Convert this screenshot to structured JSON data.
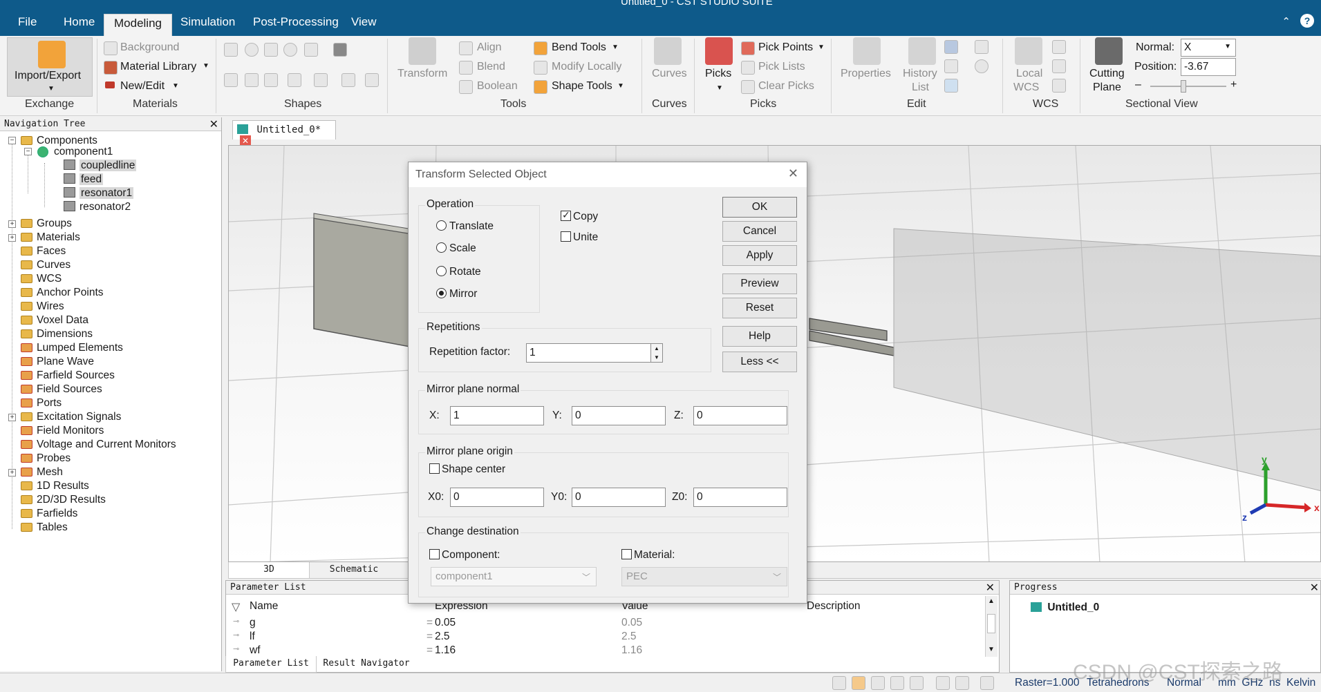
{
  "window": {
    "title": "Untitled_0 - CST STUDIO SUITE"
  },
  "menu": {
    "items": [
      "File",
      "Home",
      "Modeling",
      "Simulation",
      "Post-Processing",
      "View"
    ],
    "active": "Modeling"
  },
  "ribbon": {
    "exchange": {
      "label": "Exchange",
      "import_export": "Import/Export"
    },
    "materials": {
      "label": "Materials",
      "background": "Background",
      "material_library": "Material Library",
      "new_edit": "New/Edit"
    },
    "shapes": {
      "label": "Shapes"
    },
    "tools": {
      "label": "Tools",
      "transform": "Transform",
      "align": "Align",
      "blend": "Blend",
      "boolean": "Boolean",
      "bend_tools": "Bend Tools",
      "modify_locally": "Modify Locally",
      "shape_tools": "Shape Tools"
    },
    "curves": {
      "label": "Curves",
      "curves": "Curves"
    },
    "picks": {
      "label": "Picks",
      "picks": "Picks",
      "pick_points": "Pick Points",
      "pick_lists": "Pick Lists",
      "clear_picks": "Clear Picks"
    },
    "edit": {
      "label": "Edit",
      "properties": "Properties",
      "history": "History",
      "list": "List"
    },
    "wcs": {
      "label": "WCS",
      "local": "Local",
      "wcs": "WCS"
    },
    "sectional": {
      "label": "Sectional View",
      "cutting": "Cutting",
      "plane": "Plane",
      "normal_label": "Normal:",
      "normal_value": "X",
      "position_label": "Position:",
      "position_value": "-3.67"
    }
  },
  "nav": {
    "title": "Navigation Tree",
    "components": "Components",
    "component1": "component1",
    "solids": [
      "coupledline",
      "feed",
      "resonator1",
      "resonator2"
    ],
    "items": [
      "Groups",
      "Materials",
      "Faces",
      "Curves",
      "WCS",
      "Anchor Points",
      "Wires",
      "Voxel Data",
      "Dimensions",
      "Lumped Elements",
      "Plane Wave",
      "Farfield Sources",
      "Field Sources",
      "Ports",
      "Excitation Signals",
      "Field Monitors",
      "Voltage and Current Monitors",
      "Probes",
      "Mesh",
      "1D Results",
      "2D/3D Results",
      "Farfields",
      "Tables"
    ]
  },
  "doc_tab": {
    "label": "Untitled_0*"
  },
  "view_tabs": [
    "3D",
    "Schematic"
  ],
  "dialog": {
    "title": "Transform Selected Object",
    "operation": {
      "label": "Operation",
      "translate": "Translate",
      "scale": "Scale",
      "rotate": "Rotate",
      "mirror": "Mirror",
      "selected": "Mirror"
    },
    "copy": "Copy",
    "copy_checked": true,
    "unite": "Unite",
    "unite_checked": false,
    "buttons": {
      "ok": "OK",
      "cancel": "Cancel",
      "apply": "Apply",
      "preview": "Preview",
      "reset": "Reset",
      "help": "Help",
      "less": "Less <<"
    },
    "repetitions": {
      "label": "Repetitions",
      "factor_label": "Repetition factor:",
      "factor_value": "1"
    },
    "mirror_normal": {
      "label": "Mirror plane normal",
      "x_label": "X:",
      "x": "1",
      "y_label": "Y:",
      "y": "0",
      "z_label": "Z:",
      "z": "0"
    },
    "mirror_origin": {
      "label": "Mirror plane origin",
      "shape_center": "Shape center",
      "x0_label": "X0:",
      "x0": "0",
      "y0_label": "Y0:",
      "y0": "0",
      "z0_label": "Z0:",
      "z0": "0"
    },
    "change_dest": {
      "label": "Change destination",
      "component_label": "Component:",
      "component_value": "component1",
      "material_label": "Material:",
      "material_value": "PEC"
    }
  },
  "params": {
    "title": "Parameter List",
    "columns": [
      "Name",
      "Expression",
      "Value",
      "Description"
    ],
    "rows": [
      {
        "name": "g",
        "expr": "0.05",
        "value": "0.05"
      },
      {
        "name": "lf",
        "expr": "2.5",
        "value": "2.5"
      },
      {
        "name": "wf",
        "expr": "1.16",
        "value": "1.16"
      }
    ],
    "tabs": [
      "Parameter List",
      "Result Navigator"
    ]
  },
  "progress": {
    "title": "Progress",
    "item": "Untitled_0"
  },
  "axes": {
    "x": "x",
    "y": "y",
    "z": "z"
  },
  "status": {
    "raster": "Raster=1.000",
    "mesh": "Tetrahedrons",
    "mode": "Normal",
    "units": "mm  GHz  ns  Kelvin"
  },
  "watermark": "CSDN @CST探索之路"
}
